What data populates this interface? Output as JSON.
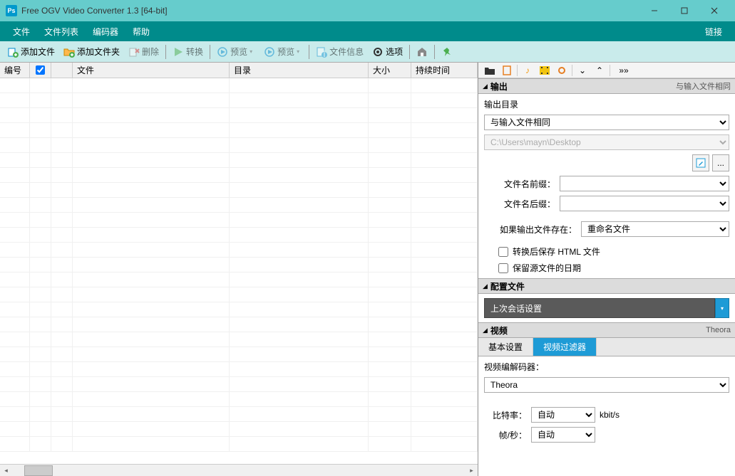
{
  "window": {
    "title": "Free OGV Video Converter 1.3  [64-bit]"
  },
  "menu": {
    "file": "文件",
    "filelist": "文件列表",
    "encoder": "编码器",
    "help": "帮助",
    "link": "链接"
  },
  "toolbar": {
    "add_file": "添加文件",
    "add_folder": "添加文件夹",
    "delete": "删除",
    "convert": "转换",
    "preview1": "预览",
    "preview2": "预览",
    "file_info": "文件信息",
    "options": "选项"
  },
  "grid": {
    "cols": {
      "no": "编号",
      "file": "文件",
      "dir": "目录",
      "size": "大小",
      "duration": "持续时间"
    }
  },
  "output": {
    "section_title": "输出",
    "section_right": "与输入文件相同",
    "dir_label": "输出目录",
    "dir_select_value": "与输入文件相同",
    "dir_path": "C:\\Users\\mayn\\Desktop",
    "prefix_label": "文件名前缀：",
    "prefix_value": "",
    "suffix_label": "文件名后缀：",
    "suffix_value": "",
    "exists_label": "如果输出文件存在：",
    "exists_value": "重命名文件",
    "chk_html": "转换后保存 HTML 文件",
    "chk_date": "保留源文件的日期"
  },
  "profile": {
    "section_title": "配置文件",
    "value": "上次会话设置"
  },
  "video": {
    "section_title": "视频",
    "section_right": "Theora",
    "tab_basic": "基本设置",
    "tab_filter": "视频过滤器",
    "codec_label": "视频编解码器：",
    "codec_value": "Theora",
    "bitrate_label": "比特率：",
    "bitrate_value": "自动",
    "bitrate_unit": "kbit/s",
    "fps_label": "帧/秒：",
    "fps_value": "自动"
  }
}
